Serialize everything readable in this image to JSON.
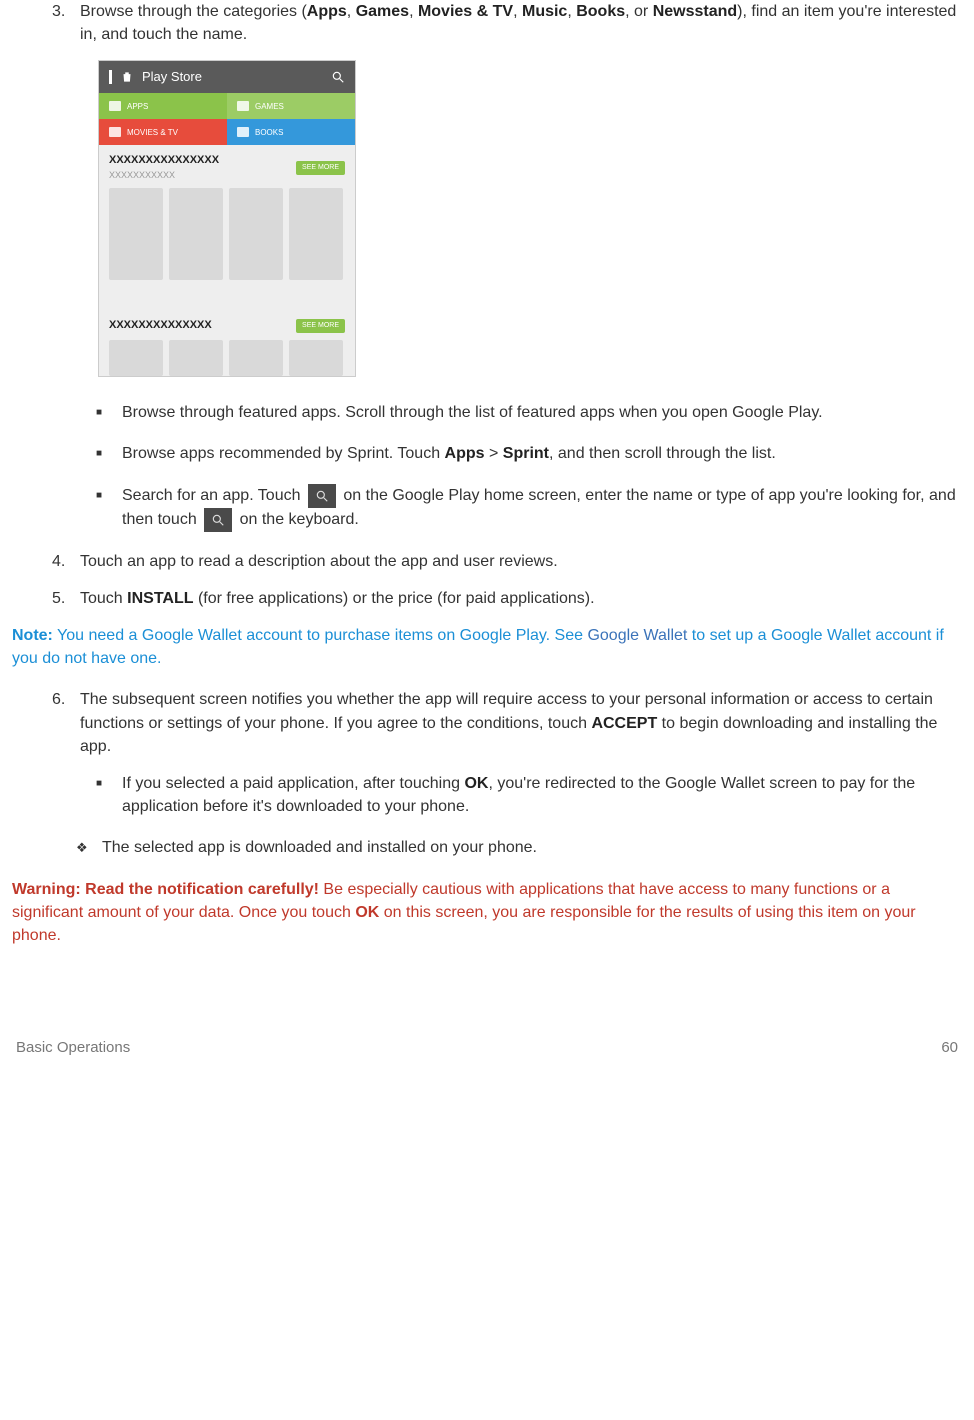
{
  "step3": {
    "num": "3.",
    "pre": "Browse through the categories (",
    "c1": "Apps",
    "s1": ", ",
    "c2": "Games",
    "s2": ", ",
    "c3": "Movies & TV",
    "s3": ", ",
    "c4": "Music",
    "s4": ", ",
    "c5": "Books",
    "s5": ", or ",
    "c6": "Newsstand",
    "post": "), find an item you're interested in, and touch the name."
  },
  "phone": {
    "title": "Play Store",
    "cat_apps": "APPS",
    "cat_games": "GAMES",
    "cat_movies": "MOVIES & TV",
    "cat_books": "BOOKS",
    "sec1_title": "XXXXXXXXXXXXXXX",
    "sec1_sub": "XXXXXXXXXXX",
    "sec1_more": "SEE MORE",
    "sec2_title": "XXXXXXXXXXXXXX",
    "sec2_more": "SEE MORE"
  },
  "bullet1": "Browse through featured apps. Scroll through the list of featured apps when you open Google Play.",
  "bullet2": {
    "pre": "Browse apps recommended by Sprint. Touch ",
    "b1": "Apps",
    "mid": " > ",
    "b2": "Sprint",
    "post": ", and then scroll through the list."
  },
  "bullet3": {
    "pre": "Search for an app. Touch ",
    "mid": " on the Google Play home screen, enter the name or type of app you're looking for, and then touch ",
    "post": " on the keyboard."
  },
  "step4": {
    "num": "4.",
    "text": "Touch an app to read a description about the app and user reviews."
  },
  "step5": {
    "num": "5.",
    "pre": "Touch ",
    "b": "INSTALL",
    "post": " (for free applications) or the price (for paid applications)."
  },
  "note": {
    "label": "Note:",
    "t1": " You need a Google Wallet account to purchase items on Google Play. See ",
    "link": "Google Wallet",
    "t2": " to set up a Google Wallet account if you do not have one."
  },
  "step6": {
    "num": "6.",
    "pre": "The subsequent screen notifies you whether the app will require access to your personal information or access to certain functions or settings of your phone. If you agree to the conditions, touch ",
    "b": "ACCEPT",
    "post": " to begin downloading and installing the app."
  },
  "sub6": {
    "pre": "If you selected a paid application, after touching ",
    "b": "OK",
    "post": ", you're redirected to the Google Wallet screen to pay for the application before it's downloaded to your phone."
  },
  "diamond": "The selected app is downloaded and installed on your phone.",
  "warning": {
    "label": "Warning: Read the notification carefully!",
    "t1": " Be especially cautious with applications that have access to many functions or a significant amount of your data. Once you touch ",
    "b": "OK",
    "t2": " on this screen, you are responsible for the results of using this item on your phone."
  },
  "footer": {
    "left": "Basic Operations",
    "right": "60"
  }
}
